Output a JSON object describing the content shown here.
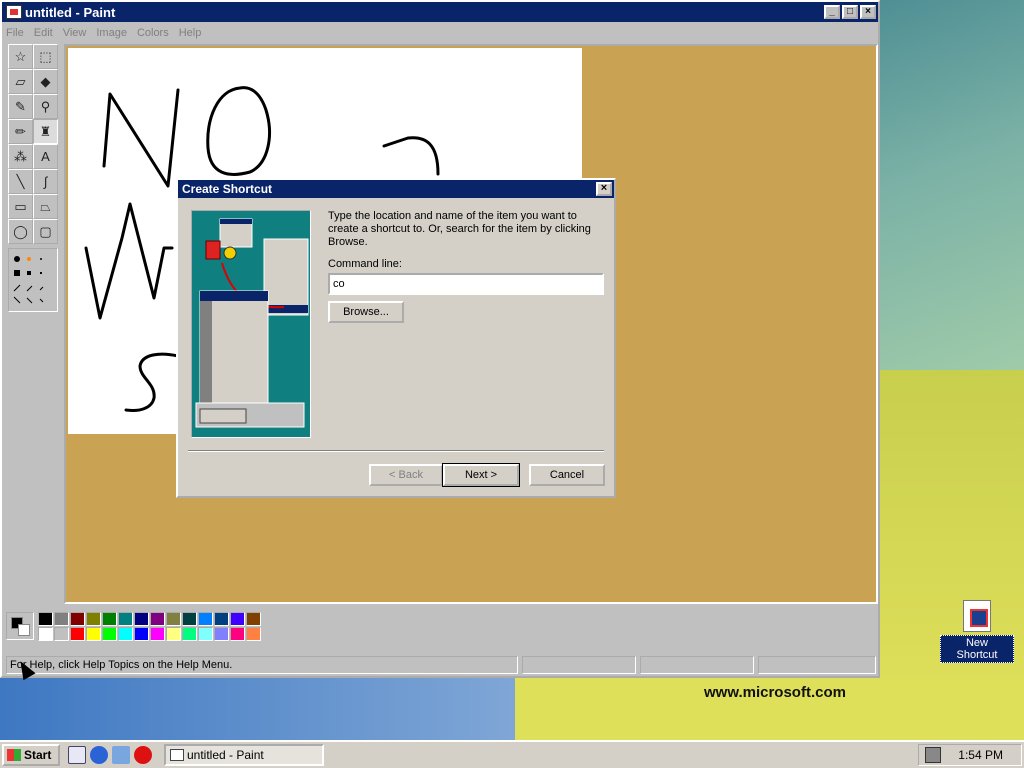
{
  "paint": {
    "title": "untitled - Paint",
    "menu": [
      "File",
      "Edit",
      "View",
      "Image",
      "Colors",
      "Help"
    ],
    "status": "For Help, click Help Topics on the Help Menu."
  },
  "dialog": {
    "title": "Create Shortcut",
    "instructions": "Type the location and name of the item you want to create a shortcut to. Or, search for the item by clicking Browse.",
    "command_label": "Command line:",
    "command_value": "co",
    "browse": "Browse...",
    "back": "< Back",
    "next": "Next >",
    "cancel": "Cancel"
  },
  "palette": [
    "#000000",
    "#808080",
    "#800000",
    "#808000",
    "#008000",
    "#008080",
    "#000080",
    "#800080",
    "#808040",
    "#004040",
    "#0080ff",
    "#004080",
    "#4000ff",
    "#804000",
    "#ffffff",
    "#c0c0c0",
    "#ff0000",
    "#ffff00",
    "#00ff00",
    "#00ffff",
    "#0000ff",
    "#ff00ff",
    "#ffff80",
    "#00ff80",
    "#80ffff",
    "#8080ff",
    "#ff0080",
    "#ff8040"
  ],
  "desktop": {
    "icon_label": "New Shortcut",
    "watermark": "www.microsoft.com"
  },
  "taskbar": {
    "start": "Start",
    "task": "untitled - Paint",
    "clock": "1:54 PM"
  }
}
